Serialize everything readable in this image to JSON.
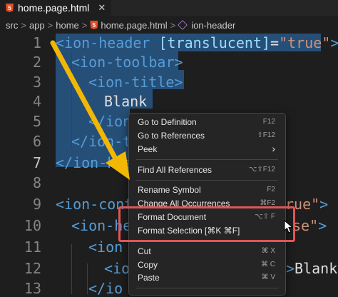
{
  "tab": {
    "icon": "html5-icon",
    "filename": "home.page.html",
    "close": "✕"
  },
  "breadcrumb": {
    "items": [
      "src",
      "app",
      "home",
      "home.page.html",
      "ion-header"
    ],
    "separator": ">"
  },
  "editor": {
    "line_numbers": [
      "1",
      "2",
      "3",
      "4",
      "5",
      "6",
      "7",
      "8",
      "9",
      "10",
      "11",
      "12",
      "13"
    ],
    "lines": [
      {
        "parts": [
          "<ion-header ",
          "[translucent]",
          "=",
          "\"true\"",
          ">"
        ]
      },
      {
        "parts": [
          "<ion-toolbar>"
        ]
      },
      {
        "parts": [
          "<ion-title>"
        ]
      },
      {
        "parts": [
          "Blank"
        ]
      },
      {
        "parts": [
          "</ion"
        ]
      },
      {
        "parts": [
          "</ion-t"
        ]
      },
      {
        "parts": [
          "</ion-hea"
        ]
      },
      {
        "parts": [
          ""
        ]
      },
      {
        "parts": [
          "<ion-cont",
          "rue\"",
          ">"
        ]
      },
      {
        "parts": [
          "<ion-he",
          "se\"",
          ">"
        ]
      },
      {
        "parts": [
          "<ion"
        ]
      },
      {
        "parts": [
          "<io",
          ">",
          "Blank"
        ]
      },
      {
        "parts": [
          "</io"
        ]
      }
    ]
  },
  "context_menu": {
    "items": [
      {
        "label": "Go to Definition",
        "shortcut": "F12"
      },
      {
        "label": "Go to References",
        "shortcut": "⇧F12"
      },
      {
        "label": "Peek",
        "shortcut": "›"
      },
      {
        "label": "Find All References",
        "shortcut": "⌥⇧F12"
      },
      {
        "label": "Rename Symbol",
        "shortcut": "F2"
      },
      {
        "label": "Change All Occurrences",
        "shortcut": "⌘F2"
      },
      {
        "label": "Format Document",
        "shortcut": "⌥⇧ F"
      },
      {
        "label": "Format Selection [⌘K ⌘F]",
        "shortcut": ""
      },
      {
        "label": "Cut",
        "shortcut": "⌘ X"
      },
      {
        "label": "Copy",
        "shortcut": "⌘ C"
      },
      {
        "label": "Paste",
        "shortcut": "⌘ V"
      }
    ]
  },
  "colors": {
    "editor_bg": "#1e1e1e",
    "selection": "#264f78",
    "tag": "#569cd6",
    "attribute": "#9cdcfe",
    "string": "#ce9178",
    "highlight_box": "#e05555",
    "arrow": "#f2b705"
  }
}
